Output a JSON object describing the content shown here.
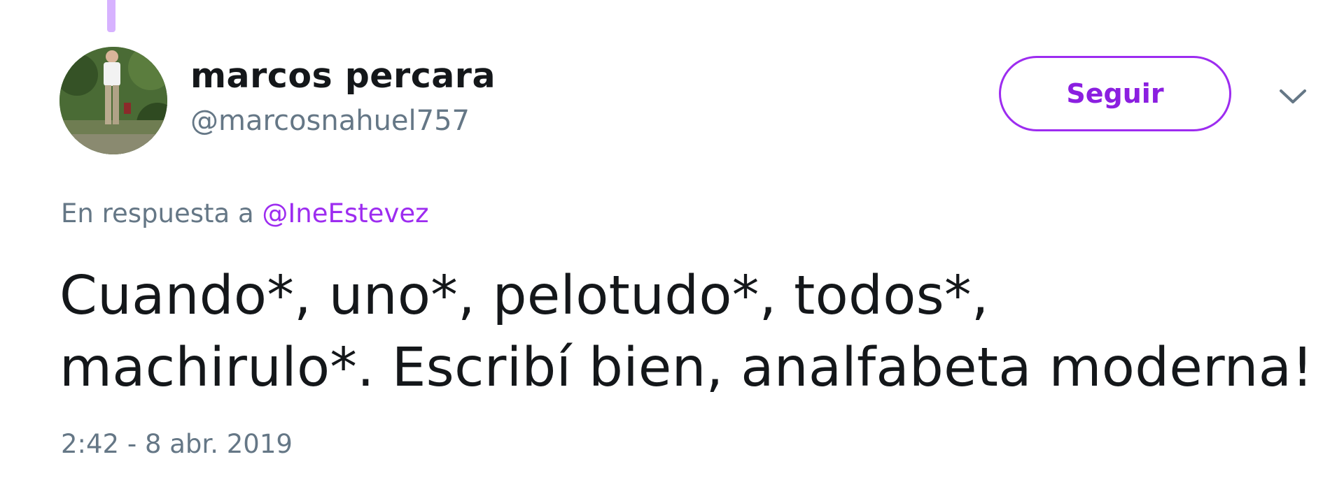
{
  "author": {
    "display_name": "marcos percara",
    "handle": "@marcosnahuel757"
  },
  "follow_button": {
    "label": "Seguir"
  },
  "menu": {
    "icon": "chevron-down-icon"
  },
  "reply": {
    "prefix": "En respuesta a ",
    "mention": "@IneEstevez"
  },
  "tweet": {
    "text_line1": "Cuando*, uno*, pelotudo*, todos*,",
    "text_line2": "machirulo*. Escribí bien, analfabeta moderna!",
    "timestamp": "2:42 - 8 abr. 2019"
  },
  "colors": {
    "accent": "#9d2cf0",
    "thread_line": "#d7b2ff",
    "secondary_text": "#657786",
    "primary_text": "#14171a"
  }
}
